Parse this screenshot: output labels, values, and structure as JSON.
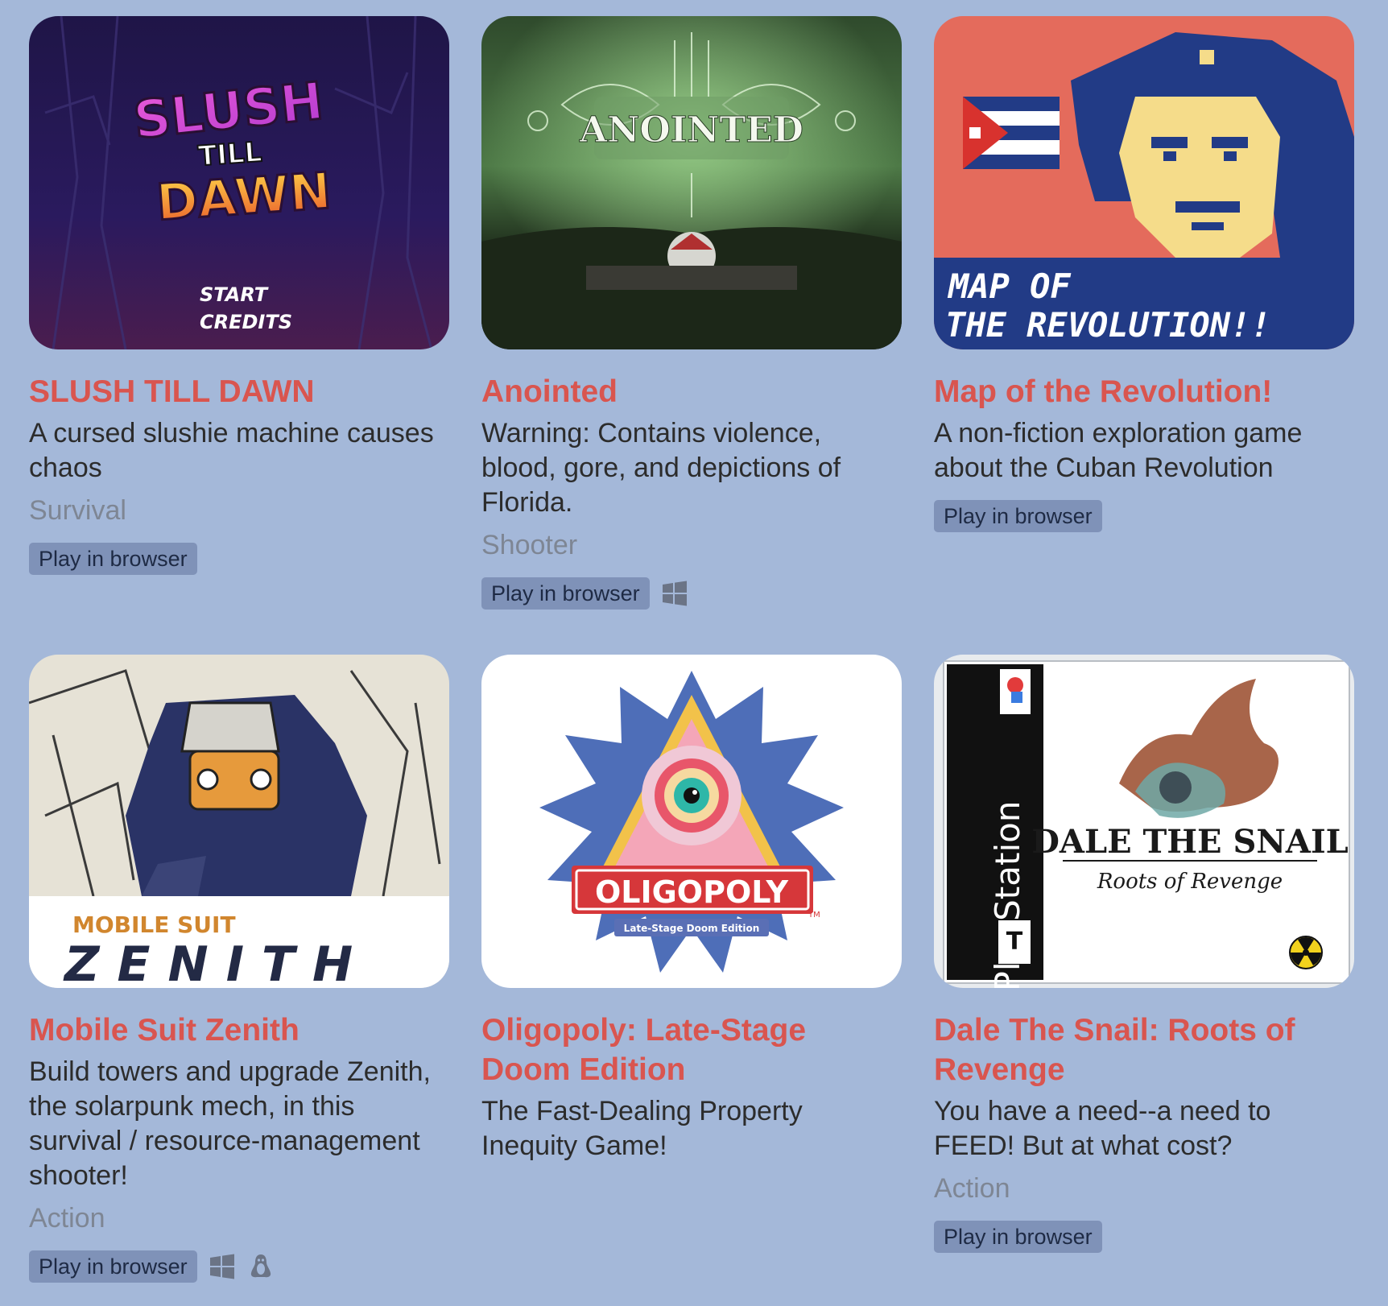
{
  "games": [
    {
      "title": "SLUSH TILL DAWN",
      "description": "A cursed slushie machine causes chaos",
      "genre": "Survival",
      "play_label": "Play in browser",
      "platforms": [],
      "cover_text": [
        "SLUSH",
        "TILL",
        "DAWN",
        "START",
        "CREDITS"
      ]
    },
    {
      "title": "Anointed",
      "description": "Warning: Contains violence, blood, gore, and depictions of Florida.",
      "genre": "Shooter",
      "play_label": "Play in browser",
      "platforms": [
        "windows-icon"
      ],
      "cover_text": [
        "ANOINTED"
      ]
    },
    {
      "title": "Map of the Revolution!",
      "description": "A non-fiction exploration game about the Cuban Revolution",
      "genre": "",
      "play_label": "Play in browser",
      "platforms": [],
      "cover_text": [
        "MAP OF",
        "THE REVOLUTION!!"
      ]
    },
    {
      "title": "Mobile Suit Zenith",
      "description": "Build towers and upgrade Zenith, the solarpunk mech, in this survival / resource-management shooter!",
      "genre": "Action",
      "play_label": "Play in browser",
      "platforms": [
        "windows-icon",
        "linux-icon"
      ],
      "cover_text": [
        "MOBILE SUIT",
        "ZENITH"
      ]
    },
    {
      "title": "Oligopoly: Late-Stage Doom Edition",
      "description": "The Fast-Dealing Property Inequity Game!",
      "genre": "",
      "play_label": "",
      "platforms": [],
      "cover_text": [
        "OLIGOPOLY",
        "Late-Stage Doom Edition",
        "TM"
      ]
    },
    {
      "title": "Dale The Snail: Roots of Revenge",
      "description": "You have a need--a need to FEED! But at what cost?",
      "genre": "Action",
      "play_label": "Play in browser",
      "platforms": [],
      "cover_text": [
        "PlayStation",
        "DALE THE SNAIL",
        "Roots of Revenge",
        "T"
      ]
    }
  ],
  "colors": {
    "background": "#a4b8d9",
    "title": "#d9554f",
    "button_bg": "#7f92b8",
    "genre": "#7e8694"
  }
}
